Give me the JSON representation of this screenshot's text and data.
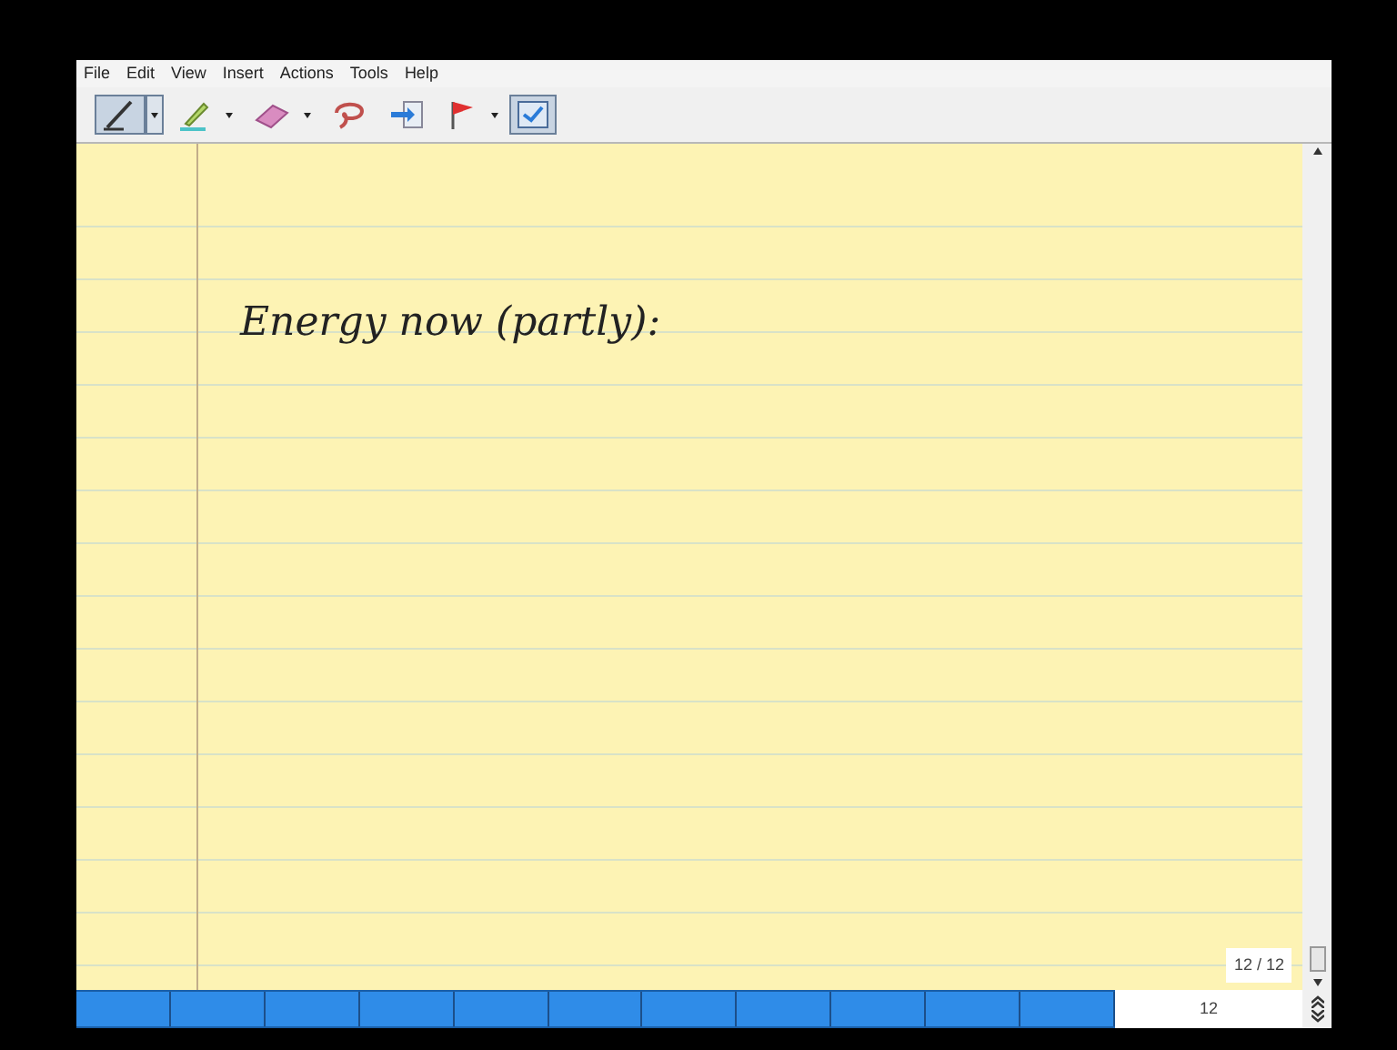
{
  "menu": [
    "File",
    "Edit",
    "View",
    "Insert",
    "Actions",
    "Tools",
    "Help"
  ],
  "toolbar": [
    {
      "kind": "pen",
      "selected": true,
      "dropdown": true
    },
    {
      "kind": "highlighter",
      "selected": false,
      "dropdown": true
    },
    {
      "kind": "eraser",
      "selected": false,
      "dropdown": true
    },
    {
      "kind": "lasso",
      "selected": false,
      "dropdown": false
    },
    {
      "kind": "insert-space",
      "selected": false,
      "dropdown": false
    },
    {
      "kind": "flag",
      "selected": false,
      "dropdown": true
    },
    {
      "kind": "selection",
      "selected": true,
      "dropdown": false
    }
  ],
  "note": {
    "handwriting": "Energy now (partly):"
  },
  "page_indicator": "12 / 12",
  "page_bar": {
    "page_number": "12"
  }
}
